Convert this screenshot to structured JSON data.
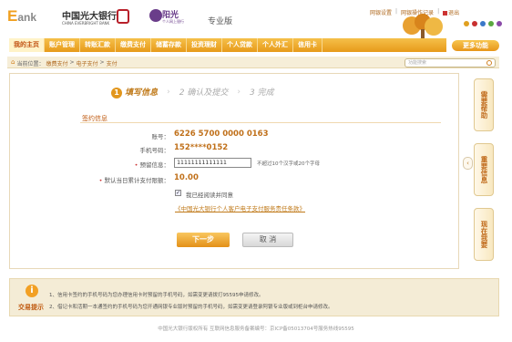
{
  "header": {
    "logo_e": "E",
    "logo_rest": "ank",
    "bank_cn": "中国光大银行",
    "bank_en": "CHINA EVERBRIGHT BANK",
    "brand": "阳光",
    "brand_sub": "个人网上银行",
    "edition": "专业版",
    "links": [
      "网银设置",
      "网银操作记录",
      "退出"
    ]
  },
  "nav": {
    "items": [
      "我的主页",
      "账户管理",
      "转账汇款",
      "缴费支付",
      "储蓄存款",
      "投资理财",
      "个人贷款",
      "个人外汇",
      "信用卡"
    ],
    "more": "更多功能"
  },
  "breadcrumb": {
    "prefix": "当前位置：",
    "items": [
      "缴费支付",
      "电子支付",
      "支付"
    ],
    "sep": ">"
  },
  "search": {
    "placeholder": "功能搜索"
  },
  "steps": [
    {
      "num": "1",
      "label": "填写信息"
    },
    {
      "label": "2 确认及提交"
    },
    {
      "label": "3 完成"
    }
  ],
  "section_title": "签约信息",
  "form": {
    "account_label": "账号：",
    "account_value": "6226 5700 0000 0163",
    "phone_label": "手机号码：",
    "phone_value": "152****0152",
    "reserved_label": "预留信息：",
    "reserved_value": "11111111111111",
    "reserved_hint": "不超过10个汉字或20个字母",
    "limit_label": "默认当日累计支付限额：",
    "limit_value": "10.00",
    "agree_label": "我已经阅读并同意",
    "agree_link": "《中国光大银行个人客户电子支付服务责任条款》"
  },
  "buttons": {
    "next": "下一步",
    "cancel": "取 消"
  },
  "sidebar": [
    "需要帮助",
    "重要信息",
    "现在我要"
  ],
  "tips": {
    "title": "交易提示",
    "lines": [
      "1、信用卡签约的手机号码为您办理信用卡时预留的手机号码，如需变更请拨打95595申请修改。",
      "2、借记卡和活期一本通签约的手机号码为您开通网银专业版时预留的手机号码，如需变更请登录阿银专业版或到柜台申请修改。"
    ]
  },
  "footer": "中国光大银行版权所有  互联网信息服务备案编号：京ICP备05013704号服务热线95595"
}
